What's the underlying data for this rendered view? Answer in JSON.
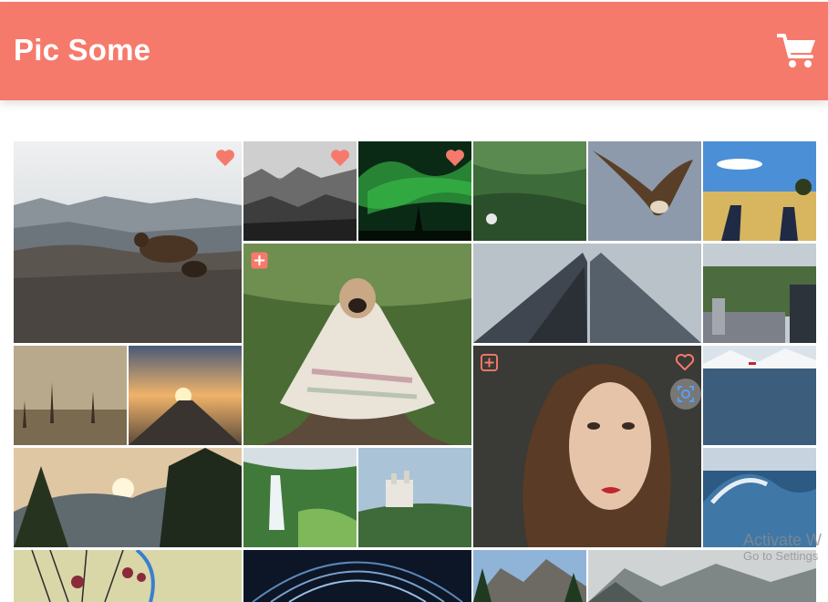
{
  "header": {
    "title": "Pic Some",
    "cart_icon": "shopping-cart-icon",
    "background": "#f67a6b"
  },
  "photos": [
    {
      "id": "bear",
      "subject": "bear cubs on rocky hill",
      "favorited": true
    },
    {
      "id": "foggy-forest",
      "subject": "foggy forest",
      "favorited": true
    },
    {
      "id": "aurora",
      "subject": "green aurora night sky",
      "favorited": true
    },
    {
      "id": "green-field",
      "subject": "green field aerial"
    },
    {
      "id": "vulture",
      "subject": "vulture in flight"
    },
    {
      "id": "feet-field",
      "subject": "feet on golden field"
    },
    {
      "id": "pug",
      "subject": "pug wrapped in blanket",
      "show_add_icon": true
    },
    {
      "id": "skyscraper",
      "subject": "skyscraper from below"
    },
    {
      "id": "nyc-park",
      "subject": "city park skyline"
    },
    {
      "id": "dead-trees",
      "subject": "dead trees in mist"
    },
    {
      "id": "railway",
      "subject": "railway at sunset"
    },
    {
      "id": "woman",
      "subject": "woman portrait",
      "show_add_icon": true,
      "show_heart_outline": true,
      "show_lens_icon": true
    },
    {
      "id": "lake",
      "subject": "lake with snowy mountains"
    },
    {
      "id": "half-dome",
      "subject": "sunset over forest valley"
    },
    {
      "id": "waterfall",
      "subject": "waterfall"
    },
    {
      "id": "castle",
      "subject": "castle on hill"
    },
    {
      "id": "wave",
      "subject": "ocean wave"
    },
    {
      "id": "ferris",
      "subject": "ferris wheel"
    },
    {
      "id": "star-trails",
      "subject": "star trails"
    },
    {
      "id": "mountains",
      "subject": "mountain peaks with trees"
    },
    {
      "id": "misty-forest",
      "subject": "misty forest"
    }
  ],
  "icons": {
    "heart_filled": "heart-icon",
    "heart_outline": "heart-outline-icon",
    "add": "add-icon",
    "lens": "lens-icon"
  },
  "colors": {
    "accent": "#f67a6b"
  },
  "watermark": {
    "line1": "Activate W",
    "line2": "Go to Settings"
  }
}
